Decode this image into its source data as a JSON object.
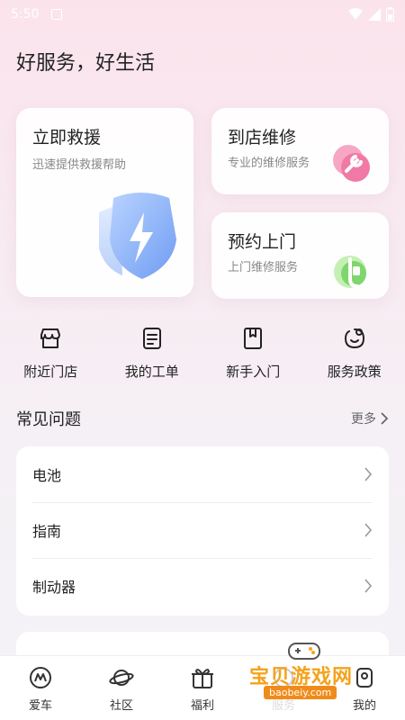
{
  "status_bar": {
    "time": "5:50"
  },
  "headline": "好服务，好生活",
  "cards": {
    "rescue": {
      "title": "立即救援",
      "subtitle": "迅速提供救援帮助"
    },
    "store": {
      "title": "到店维修",
      "subtitle": "专业的维修服务"
    },
    "home": {
      "title": "预约上门",
      "subtitle": "上门维修服务"
    }
  },
  "quick_actions": [
    "附近门店",
    "我的工单",
    "新手入门",
    "服务政策"
  ],
  "faq": {
    "title": "常见问题",
    "more": "更多",
    "items": [
      "电池",
      "指南",
      "制动器"
    ]
  },
  "tabs": [
    "爱车",
    "社区",
    "福利",
    "服务",
    "我的"
  ],
  "watermark": {
    "text": "宝贝游戏网",
    "url": "baobeiy.com"
  },
  "colors": {
    "accent_blue": "#6f9cf2",
    "accent_pink": "#f07aa5",
    "accent_green": "#7fd66d",
    "watermark_orange": "#f5a21b"
  }
}
